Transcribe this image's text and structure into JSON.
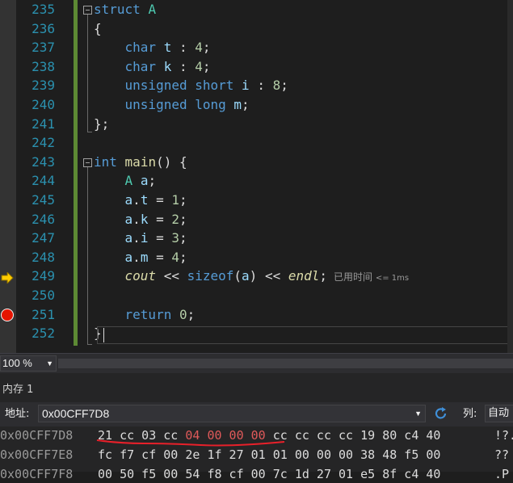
{
  "editor": {
    "lines": [
      {
        "n": "235",
        "t": [
          [
            "kw",
            "struct"
          ],
          [
            "id",
            " "
          ],
          [
            "ty",
            "A"
          ]
        ]
      },
      {
        "n": "236",
        "t": [
          [
            "id",
            "{"
          ]
        ]
      },
      {
        "n": "237",
        "t": [
          [
            "id",
            "    "
          ],
          [
            "kw",
            "char"
          ],
          [
            "id",
            " "
          ],
          [
            "var",
            "t"
          ],
          [
            "id",
            " : "
          ],
          [
            "num",
            "4"
          ],
          [
            "id",
            ";"
          ]
        ]
      },
      {
        "n": "238",
        "t": [
          [
            "id",
            "    "
          ],
          [
            "kw",
            "char"
          ],
          [
            "id",
            " "
          ],
          [
            "var",
            "k"
          ],
          [
            "id",
            " : "
          ],
          [
            "num",
            "4"
          ],
          [
            "id",
            ";"
          ]
        ]
      },
      {
        "n": "239",
        "t": [
          [
            "id",
            "    "
          ],
          [
            "kw",
            "unsigned"
          ],
          [
            "id",
            " "
          ],
          [
            "kw",
            "short"
          ],
          [
            "id",
            " "
          ],
          [
            "var",
            "i"
          ],
          [
            "id",
            " : "
          ],
          [
            "num",
            "8"
          ],
          [
            "id",
            ";"
          ]
        ]
      },
      {
        "n": "240",
        "t": [
          [
            "id",
            "    "
          ],
          [
            "kw",
            "unsigned"
          ],
          [
            "id",
            " "
          ],
          [
            "kw",
            "long"
          ],
          [
            "id",
            " "
          ],
          [
            "var",
            "m"
          ],
          [
            "id",
            ";"
          ]
        ]
      },
      {
        "n": "241",
        "t": [
          [
            "id",
            "};"
          ]
        ]
      },
      {
        "n": "242",
        "t": []
      },
      {
        "n": "243",
        "t": [
          [
            "kw",
            "int"
          ],
          [
            "id",
            " "
          ],
          [
            "fn",
            "main"
          ],
          [
            "id",
            "() {"
          ]
        ]
      },
      {
        "n": "244",
        "t": [
          [
            "id",
            "    "
          ],
          [
            "ty",
            "A"
          ],
          [
            "id",
            " "
          ],
          [
            "var",
            "a"
          ],
          [
            "id",
            ";"
          ]
        ]
      },
      {
        "n": "245",
        "t": [
          [
            "id",
            "    "
          ],
          [
            "var",
            "a"
          ],
          [
            "id",
            "."
          ],
          [
            "var",
            "t"
          ],
          [
            "id",
            " = "
          ],
          [
            "num",
            "1"
          ],
          [
            "id",
            ";"
          ]
        ]
      },
      {
        "n": "246",
        "t": [
          [
            "id",
            "    "
          ],
          [
            "var",
            "a"
          ],
          [
            "id",
            "."
          ],
          [
            "var",
            "k"
          ],
          [
            "id",
            " = "
          ],
          [
            "num",
            "2"
          ],
          [
            "id",
            ";"
          ]
        ]
      },
      {
        "n": "247",
        "t": [
          [
            "id",
            "    "
          ],
          [
            "var",
            "a"
          ],
          [
            "id",
            "."
          ],
          [
            "var",
            "i"
          ],
          [
            "id",
            " = "
          ],
          [
            "num",
            "3"
          ],
          [
            "id",
            ";"
          ]
        ]
      },
      {
        "n": "248",
        "t": [
          [
            "id",
            "    "
          ],
          [
            "var",
            "a"
          ],
          [
            "id",
            "."
          ],
          [
            "var",
            "m"
          ],
          [
            "id",
            " = "
          ],
          [
            "num",
            "4"
          ],
          [
            "id",
            ";"
          ]
        ]
      },
      {
        "n": "249",
        "t": [
          [
            "id",
            "    "
          ],
          [
            "ital",
            "cout"
          ],
          [
            "id",
            " << "
          ],
          [
            "kw",
            "sizeof"
          ],
          [
            "id",
            "("
          ],
          [
            "var",
            "a"
          ],
          [
            "id",
            ") << "
          ],
          [
            "endl",
            "endl"
          ],
          [
            "id",
            ";"
          ]
        ]
      },
      {
        "n": "250",
        "t": []
      },
      {
        "n": "251",
        "t": [
          [
            "id",
            "    "
          ],
          [
            "kw",
            "return"
          ],
          [
            "id",
            " "
          ],
          [
            "num",
            "0"
          ],
          [
            "id",
            ";"
          ]
        ]
      },
      {
        "n": "252",
        "t": [
          [
            "id",
            "}"
          ]
        ]
      }
    ],
    "perf_tip": "已用时间",
    "perf_value": "<= 1ms"
  },
  "zoom": {
    "value": "100 %"
  },
  "memory": {
    "title": "内存 1",
    "address_label": "地址:",
    "address_value": "0x00CFF7D8",
    "column_label": "列:",
    "column_value": "自动",
    "rows": [
      {
        "addr": "0x00CFF7D8",
        "normal1": "21 cc 03 cc ",
        "changed": "04 00 00 00",
        "normal2": " cc cc cc cc 19 80 c4 40",
        "ascii": "!?."
      },
      {
        "addr": "0x00CFF7E8",
        "normal1": "fc f7 cf 00 2e 1f 27 01 01 00 00 00 38 48 f5 00",
        "changed": "",
        "normal2": "",
        "ascii": "??"
      },
      {
        "addr": "0x00CFF7F8",
        "normal1": "00 50 f5 00 54 f8 cf 00 7c 1d 27 01 e5 8f c4 40",
        "changed": "",
        "normal2": "",
        "ascii": ".P"
      }
    ]
  },
  "colors": {
    "keyword": "#569cd6",
    "type": "#4ec9b0",
    "function": "#dcdcaa",
    "number": "#b5cea8",
    "changed_bytes": "#e05a5a",
    "breakpoint": "#e51400",
    "change_bar": "#5d8a34"
  }
}
